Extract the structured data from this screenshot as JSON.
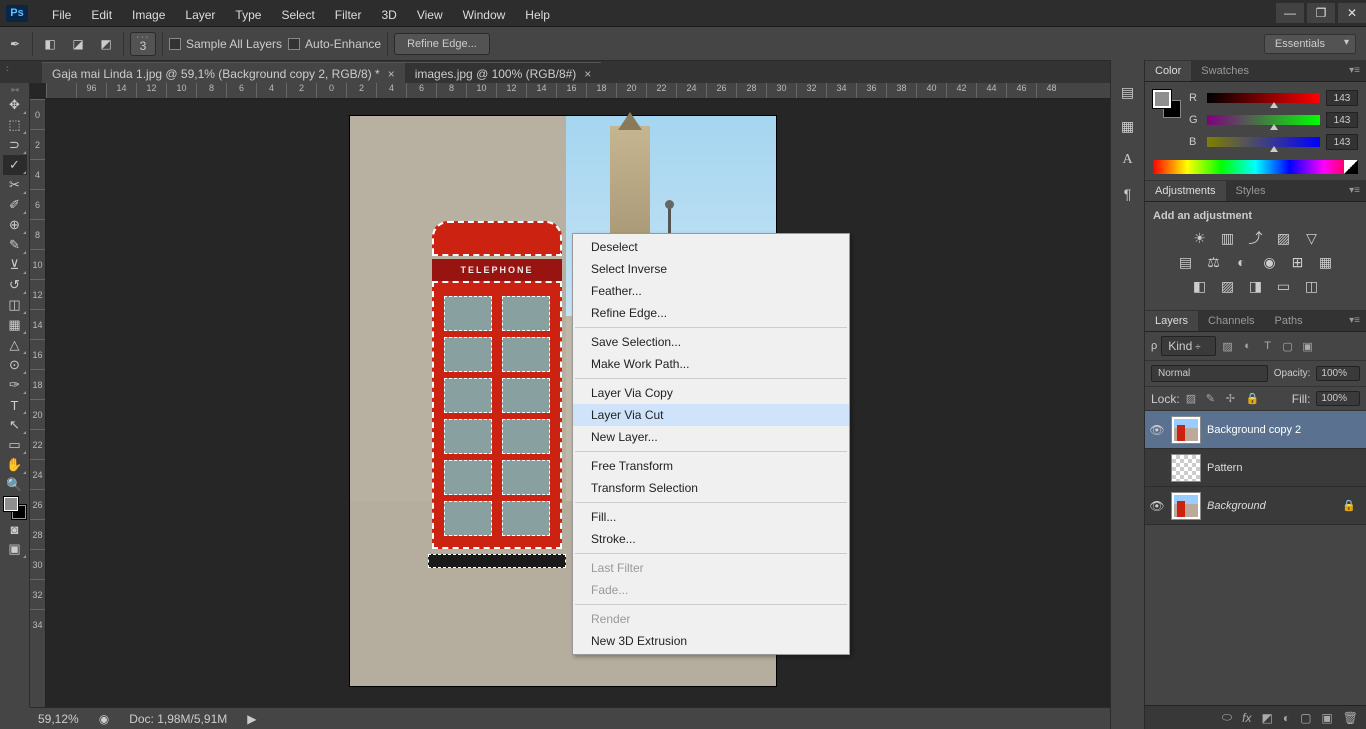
{
  "menubar": [
    "File",
    "Edit",
    "Image",
    "Layer",
    "Type",
    "Select",
    "Filter",
    "3D",
    "View",
    "Window",
    "Help"
  ],
  "optionbar": {
    "brush_size": "3",
    "sample_all": "Sample All Layers",
    "auto_enhance": "Auto-Enhance",
    "refine_edge": "Refine Edge...",
    "workspace": "Essentials"
  },
  "tabs": [
    {
      "label": "Gaja mai Linda 1.jpg @ 59,1% (Background copy 2, RGB/8) *",
      "active": true
    },
    {
      "label": "images.jpg @ 100% (RGB/8#)",
      "active": false
    }
  ],
  "ruler_h": [
    "",
    "96",
    "14",
    "12",
    "10",
    "8",
    "6",
    "4",
    "2",
    "0",
    "2",
    "4",
    "6",
    "8",
    "10",
    "12",
    "14",
    "16",
    "18",
    "20",
    "22",
    "24",
    "26",
    "28",
    "30",
    "32",
    "34",
    "36",
    "38",
    "40",
    "42",
    "44",
    "46",
    "48"
  ],
  "ruler_v": [
    "0",
    "2",
    "4",
    "6",
    "8",
    "10",
    "12",
    "14",
    "16",
    "18",
    "20",
    "22",
    "24",
    "26",
    "28",
    "30",
    "32",
    "34"
  ],
  "booth_sign": "TELEPHONE",
  "status": {
    "zoom": "59,12%",
    "doc": "Doc: 1,98M/5,91M"
  },
  "context_menu": [
    {
      "label": "Deselect"
    },
    {
      "label": "Select Inverse"
    },
    {
      "label": "Feather..."
    },
    {
      "label": "Refine Edge..."
    },
    {
      "sep": true
    },
    {
      "label": "Save Selection..."
    },
    {
      "label": "Make Work Path..."
    },
    {
      "sep": true
    },
    {
      "label": "Layer Via Copy"
    },
    {
      "label": "Layer Via Cut",
      "hover": true
    },
    {
      "label": "New Layer..."
    },
    {
      "sep": true
    },
    {
      "label": "Free Transform"
    },
    {
      "label": "Transform Selection"
    },
    {
      "sep": true
    },
    {
      "label": "Fill..."
    },
    {
      "label": "Stroke..."
    },
    {
      "sep": true
    },
    {
      "label": "Last Filter",
      "disabled": true
    },
    {
      "label": "Fade...",
      "disabled": true
    },
    {
      "sep": true
    },
    {
      "label": "Render",
      "disabled": true
    },
    {
      "label": "New 3D Extrusion"
    }
  ],
  "color_panel": {
    "tabs": [
      "Color",
      "Swatches"
    ],
    "r": {
      "label": "R",
      "val": "143"
    },
    "g": {
      "label": "G",
      "val": "143"
    },
    "b": {
      "label": "B",
      "val": "143"
    }
  },
  "adjustments": {
    "tabs": [
      "Adjustments",
      "Styles"
    ],
    "title": "Add an adjustment"
  },
  "layers_panel": {
    "tabs": [
      "Layers",
      "Channels",
      "Paths"
    ],
    "kind": "Kind",
    "blend": "Normal",
    "opacity_label": "Opacity:",
    "opacity": "100%",
    "lock_label": "Lock:",
    "fill_label": "Fill:",
    "fill": "100%",
    "layers": [
      {
        "name": "Background copy 2",
        "visible": true,
        "active": true
      },
      {
        "name": "Pattern",
        "visible": false,
        "pattern": true
      },
      {
        "name": "Background",
        "visible": true,
        "italic": true,
        "locked": true
      }
    ]
  },
  "ps_logo": "Ps"
}
